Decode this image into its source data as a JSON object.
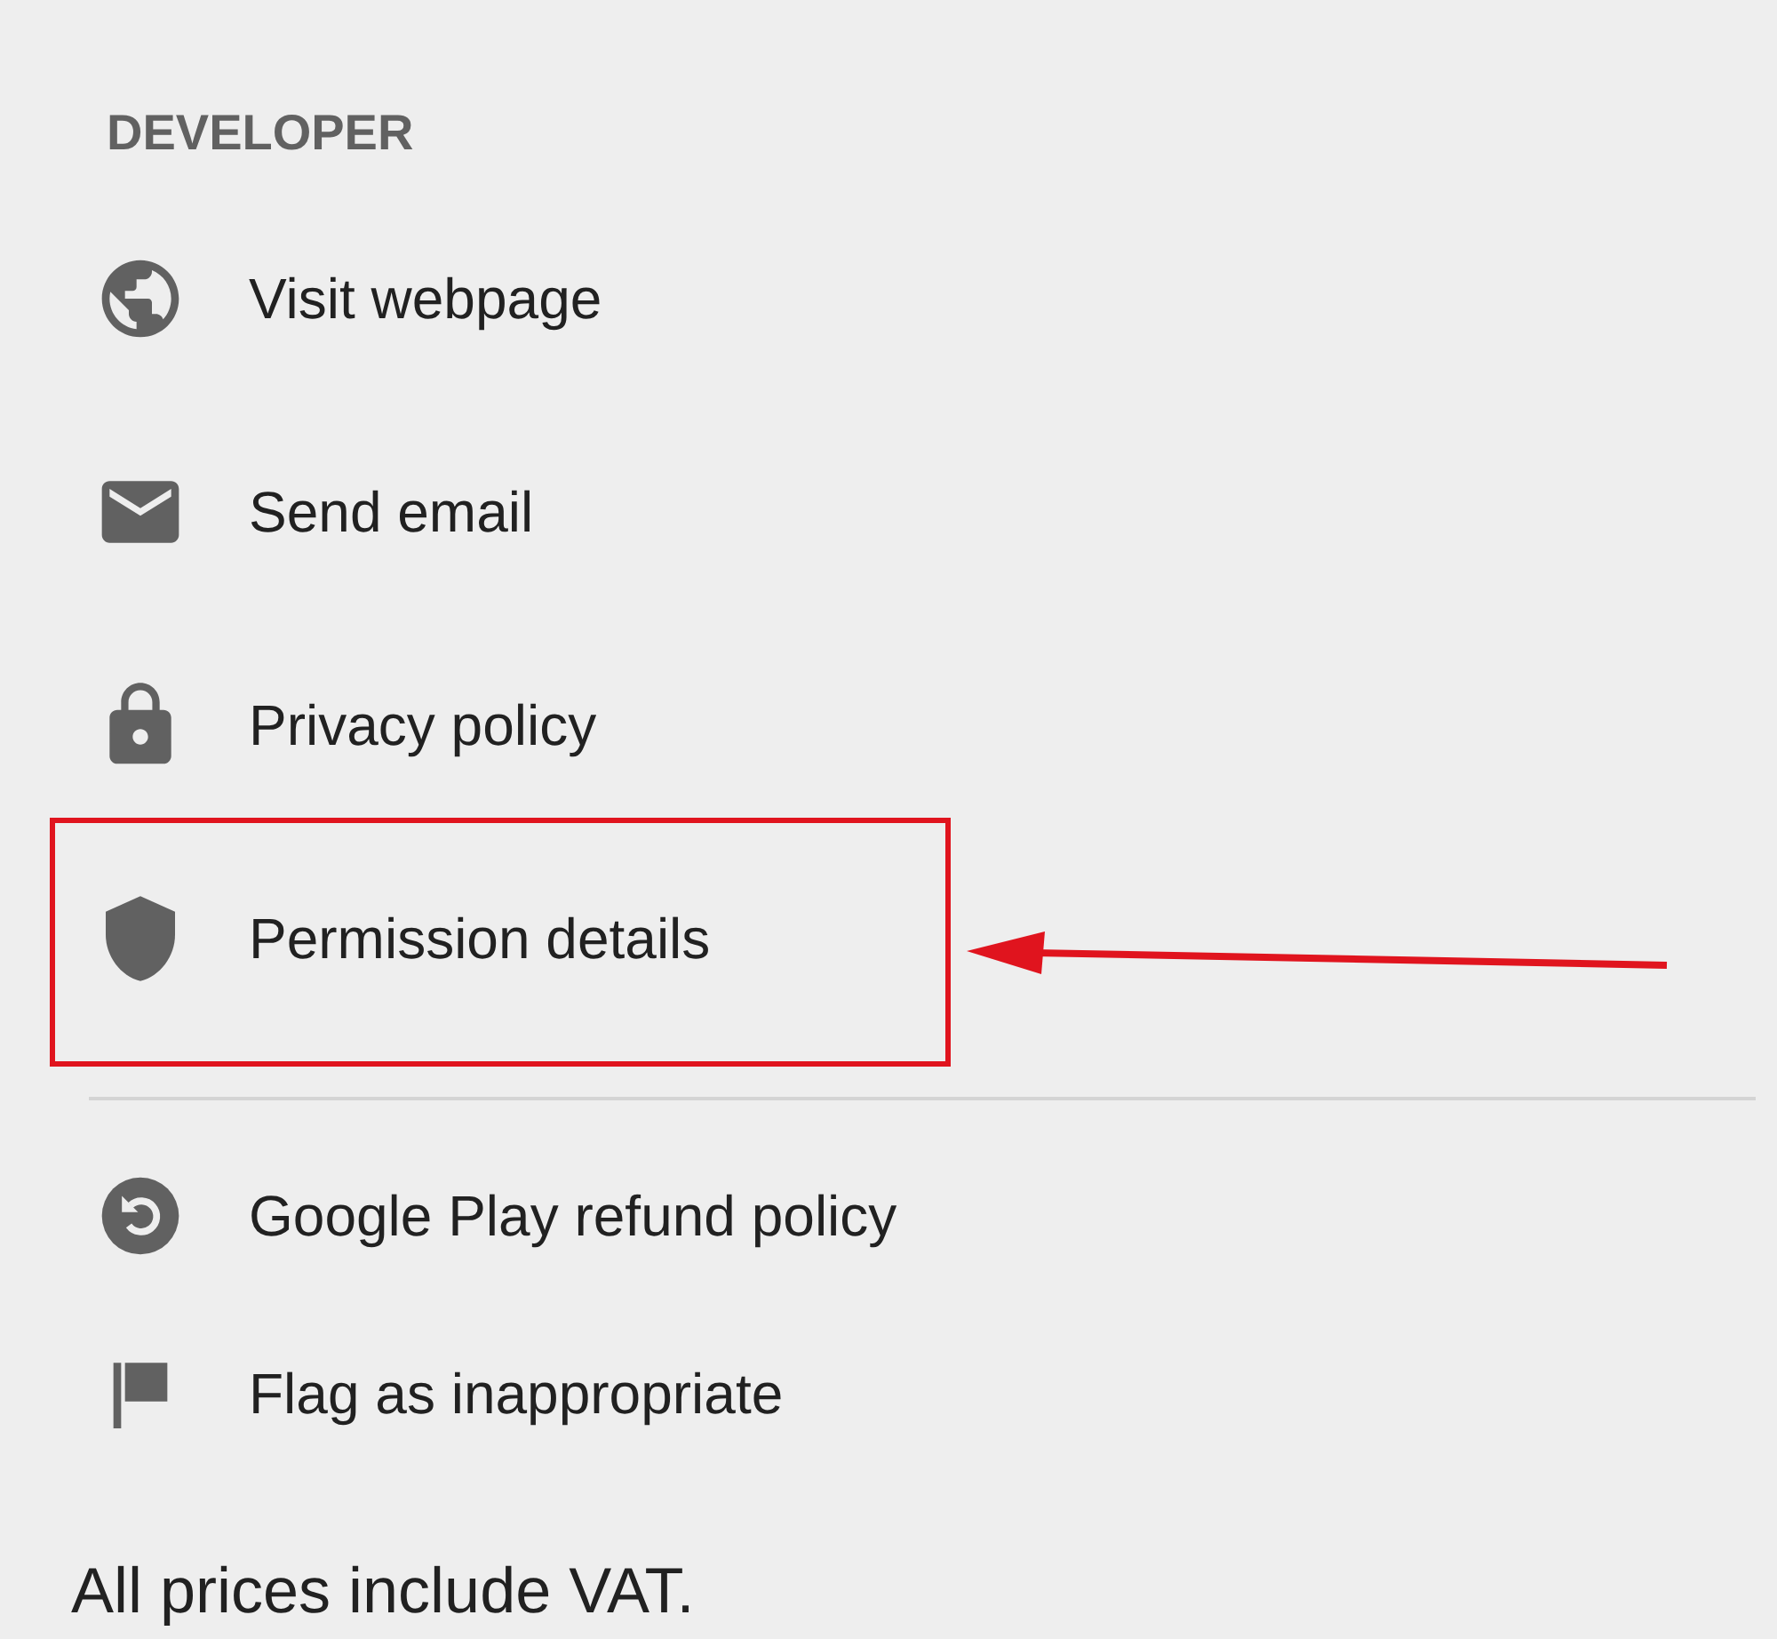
{
  "section": {
    "title": "DEVELOPER"
  },
  "developer_links": [
    {
      "label": "Visit webpage",
      "highlighted": false
    },
    {
      "label": "Send email",
      "highlighted": false
    },
    {
      "label": "Privacy policy",
      "highlighted": false
    },
    {
      "label": "Permission details",
      "highlighted": true
    }
  ],
  "store_links": [
    {
      "label": "Google Play refund policy"
    },
    {
      "label": "Flag as inappropriate"
    }
  ],
  "footer": "All prices include VAT."
}
